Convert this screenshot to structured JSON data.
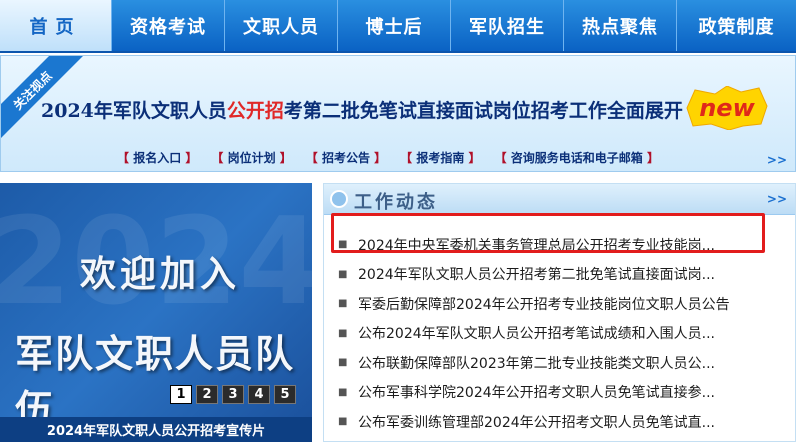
{
  "nav": {
    "items": [
      "首页",
      "资格考试",
      "文职人员",
      "博士后",
      "军队招生",
      "热点聚焦",
      "政策制度"
    ],
    "active_index": 0
  },
  "banner": {
    "ribbon": "关注视点",
    "headline_pre": "2024年军队文职人员",
    "headline_red": "公开招",
    "headline_post": "考第二批免笔试直接面试岗位招考工作全面展开",
    "new_badge": "new",
    "links": [
      "报名入口",
      "岗位计划",
      "招考公告",
      "报考指南",
      "咨询服务电话和电子邮箱"
    ],
    "more": ">>"
  },
  "promo": {
    "watermark": "2024",
    "line1": "欢迎加入",
    "line2": "军队文职人员队伍",
    "pages": [
      "1",
      "2",
      "3",
      "4",
      "5"
    ],
    "active_page": 0,
    "caption": "2024年军队文职人员公开招考宣传片"
  },
  "news": {
    "title": "工作动态",
    "more": ">>",
    "items": [
      "2024年中央军委机关事务管理总局公开招考专业技能岗...",
      "2024年军队文职人员公开招考第二批免笔试直接面试岗...",
      "军委后勤保障部2024年公开招考专业技能岗位文职人员公告",
      "公布2024年军队文职人员公开招考笔试成绩和入围人员...",
      "公布联勤保障部队2023年第二批专业技能类文职人员公...",
      "公布军事科学院2024年公开招考文职人员免笔试直接参...",
      "公布军委训练管理部2024年公开招考文职人员免笔试直..."
    ]
  },
  "colors": {
    "nav_blue": "#0a62c4",
    "headline_navy": "#0b2f78",
    "accent_red": "#e21c1c",
    "badge_yellow": "#ffd400"
  }
}
